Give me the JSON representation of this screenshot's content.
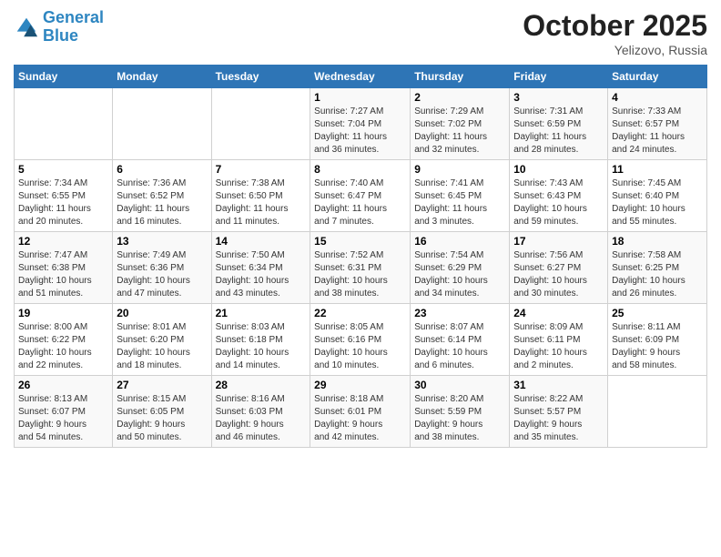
{
  "header": {
    "logo_line1": "General",
    "logo_line2": "Blue",
    "month": "October 2025",
    "location": "Yelizovo, Russia"
  },
  "days_of_week": [
    "Sunday",
    "Monday",
    "Tuesday",
    "Wednesday",
    "Thursday",
    "Friday",
    "Saturday"
  ],
  "weeks": [
    [
      {
        "day": "",
        "info": ""
      },
      {
        "day": "",
        "info": ""
      },
      {
        "day": "",
        "info": ""
      },
      {
        "day": "1",
        "info": "Sunrise: 7:27 AM\nSunset: 7:04 PM\nDaylight: 11 hours\nand 36 minutes."
      },
      {
        "day": "2",
        "info": "Sunrise: 7:29 AM\nSunset: 7:02 PM\nDaylight: 11 hours\nand 32 minutes."
      },
      {
        "day": "3",
        "info": "Sunrise: 7:31 AM\nSunset: 6:59 PM\nDaylight: 11 hours\nand 28 minutes."
      },
      {
        "day": "4",
        "info": "Sunrise: 7:33 AM\nSunset: 6:57 PM\nDaylight: 11 hours\nand 24 minutes."
      }
    ],
    [
      {
        "day": "5",
        "info": "Sunrise: 7:34 AM\nSunset: 6:55 PM\nDaylight: 11 hours\nand 20 minutes."
      },
      {
        "day": "6",
        "info": "Sunrise: 7:36 AM\nSunset: 6:52 PM\nDaylight: 11 hours\nand 16 minutes."
      },
      {
        "day": "7",
        "info": "Sunrise: 7:38 AM\nSunset: 6:50 PM\nDaylight: 11 hours\nand 11 minutes."
      },
      {
        "day": "8",
        "info": "Sunrise: 7:40 AM\nSunset: 6:47 PM\nDaylight: 11 hours\nand 7 minutes."
      },
      {
        "day": "9",
        "info": "Sunrise: 7:41 AM\nSunset: 6:45 PM\nDaylight: 11 hours\nand 3 minutes."
      },
      {
        "day": "10",
        "info": "Sunrise: 7:43 AM\nSunset: 6:43 PM\nDaylight: 10 hours\nand 59 minutes."
      },
      {
        "day": "11",
        "info": "Sunrise: 7:45 AM\nSunset: 6:40 PM\nDaylight: 10 hours\nand 55 minutes."
      }
    ],
    [
      {
        "day": "12",
        "info": "Sunrise: 7:47 AM\nSunset: 6:38 PM\nDaylight: 10 hours\nand 51 minutes."
      },
      {
        "day": "13",
        "info": "Sunrise: 7:49 AM\nSunset: 6:36 PM\nDaylight: 10 hours\nand 47 minutes."
      },
      {
        "day": "14",
        "info": "Sunrise: 7:50 AM\nSunset: 6:34 PM\nDaylight: 10 hours\nand 43 minutes."
      },
      {
        "day": "15",
        "info": "Sunrise: 7:52 AM\nSunset: 6:31 PM\nDaylight: 10 hours\nand 38 minutes."
      },
      {
        "day": "16",
        "info": "Sunrise: 7:54 AM\nSunset: 6:29 PM\nDaylight: 10 hours\nand 34 minutes."
      },
      {
        "day": "17",
        "info": "Sunrise: 7:56 AM\nSunset: 6:27 PM\nDaylight: 10 hours\nand 30 minutes."
      },
      {
        "day": "18",
        "info": "Sunrise: 7:58 AM\nSunset: 6:25 PM\nDaylight: 10 hours\nand 26 minutes."
      }
    ],
    [
      {
        "day": "19",
        "info": "Sunrise: 8:00 AM\nSunset: 6:22 PM\nDaylight: 10 hours\nand 22 minutes."
      },
      {
        "day": "20",
        "info": "Sunrise: 8:01 AM\nSunset: 6:20 PM\nDaylight: 10 hours\nand 18 minutes."
      },
      {
        "day": "21",
        "info": "Sunrise: 8:03 AM\nSunset: 6:18 PM\nDaylight: 10 hours\nand 14 minutes."
      },
      {
        "day": "22",
        "info": "Sunrise: 8:05 AM\nSunset: 6:16 PM\nDaylight: 10 hours\nand 10 minutes."
      },
      {
        "day": "23",
        "info": "Sunrise: 8:07 AM\nSunset: 6:14 PM\nDaylight: 10 hours\nand 6 minutes."
      },
      {
        "day": "24",
        "info": "Sunrise: 8:09 AM\nSunset: 6:11 PM\nDaylight: 10 hours\nand 2 minutes."
      },
      {
        "day": "25",
        "info": "Sunrise: 8:11 AM\nSunset: 6:09 PM\nDaylight: 9 hours\nand 58 minutes."
      }
    ],
    [
      {
        "day": "26",
        "info": "Sunrise: 8:13 AM\nSunset: 6:07 PM\nDaylight: 9 hours\nand 54 minutes."
      },
      {
        "day": "27",
        "info": "Sunrise: 8:15 AM\nSunset: 6:05 PM\nDaylight: 9 hours\nand 50 minutes."
      },
      {
        "day": "28",
        "info": "Sunrise: 8:16 AM\nSunset: 6:03 PM\nDaylight: 9 hours\nand 46 minutes."
      },
      {
        "day": "29",
        "info": "Sunrise: 8:18 AM\nSunset: 6:01 PM\nDaylight: 9 hours\nand 42 minutes."
      },
      {
        "day": "30",
        "info": "Sunrise: 8:20 AM\nSunset: 5:59 PM\nDaylight: 9 hours\nand 38 minutes."
      },
      {
        "day": "31",
        "info": "Sunrise: 8:22 AM\nSunset: 5:57 PM\nDaylight: 9 hours\nand 35 minutes."
      },
      {
        "day": "",
        "info": ""
      }
    ]
  ]
}
